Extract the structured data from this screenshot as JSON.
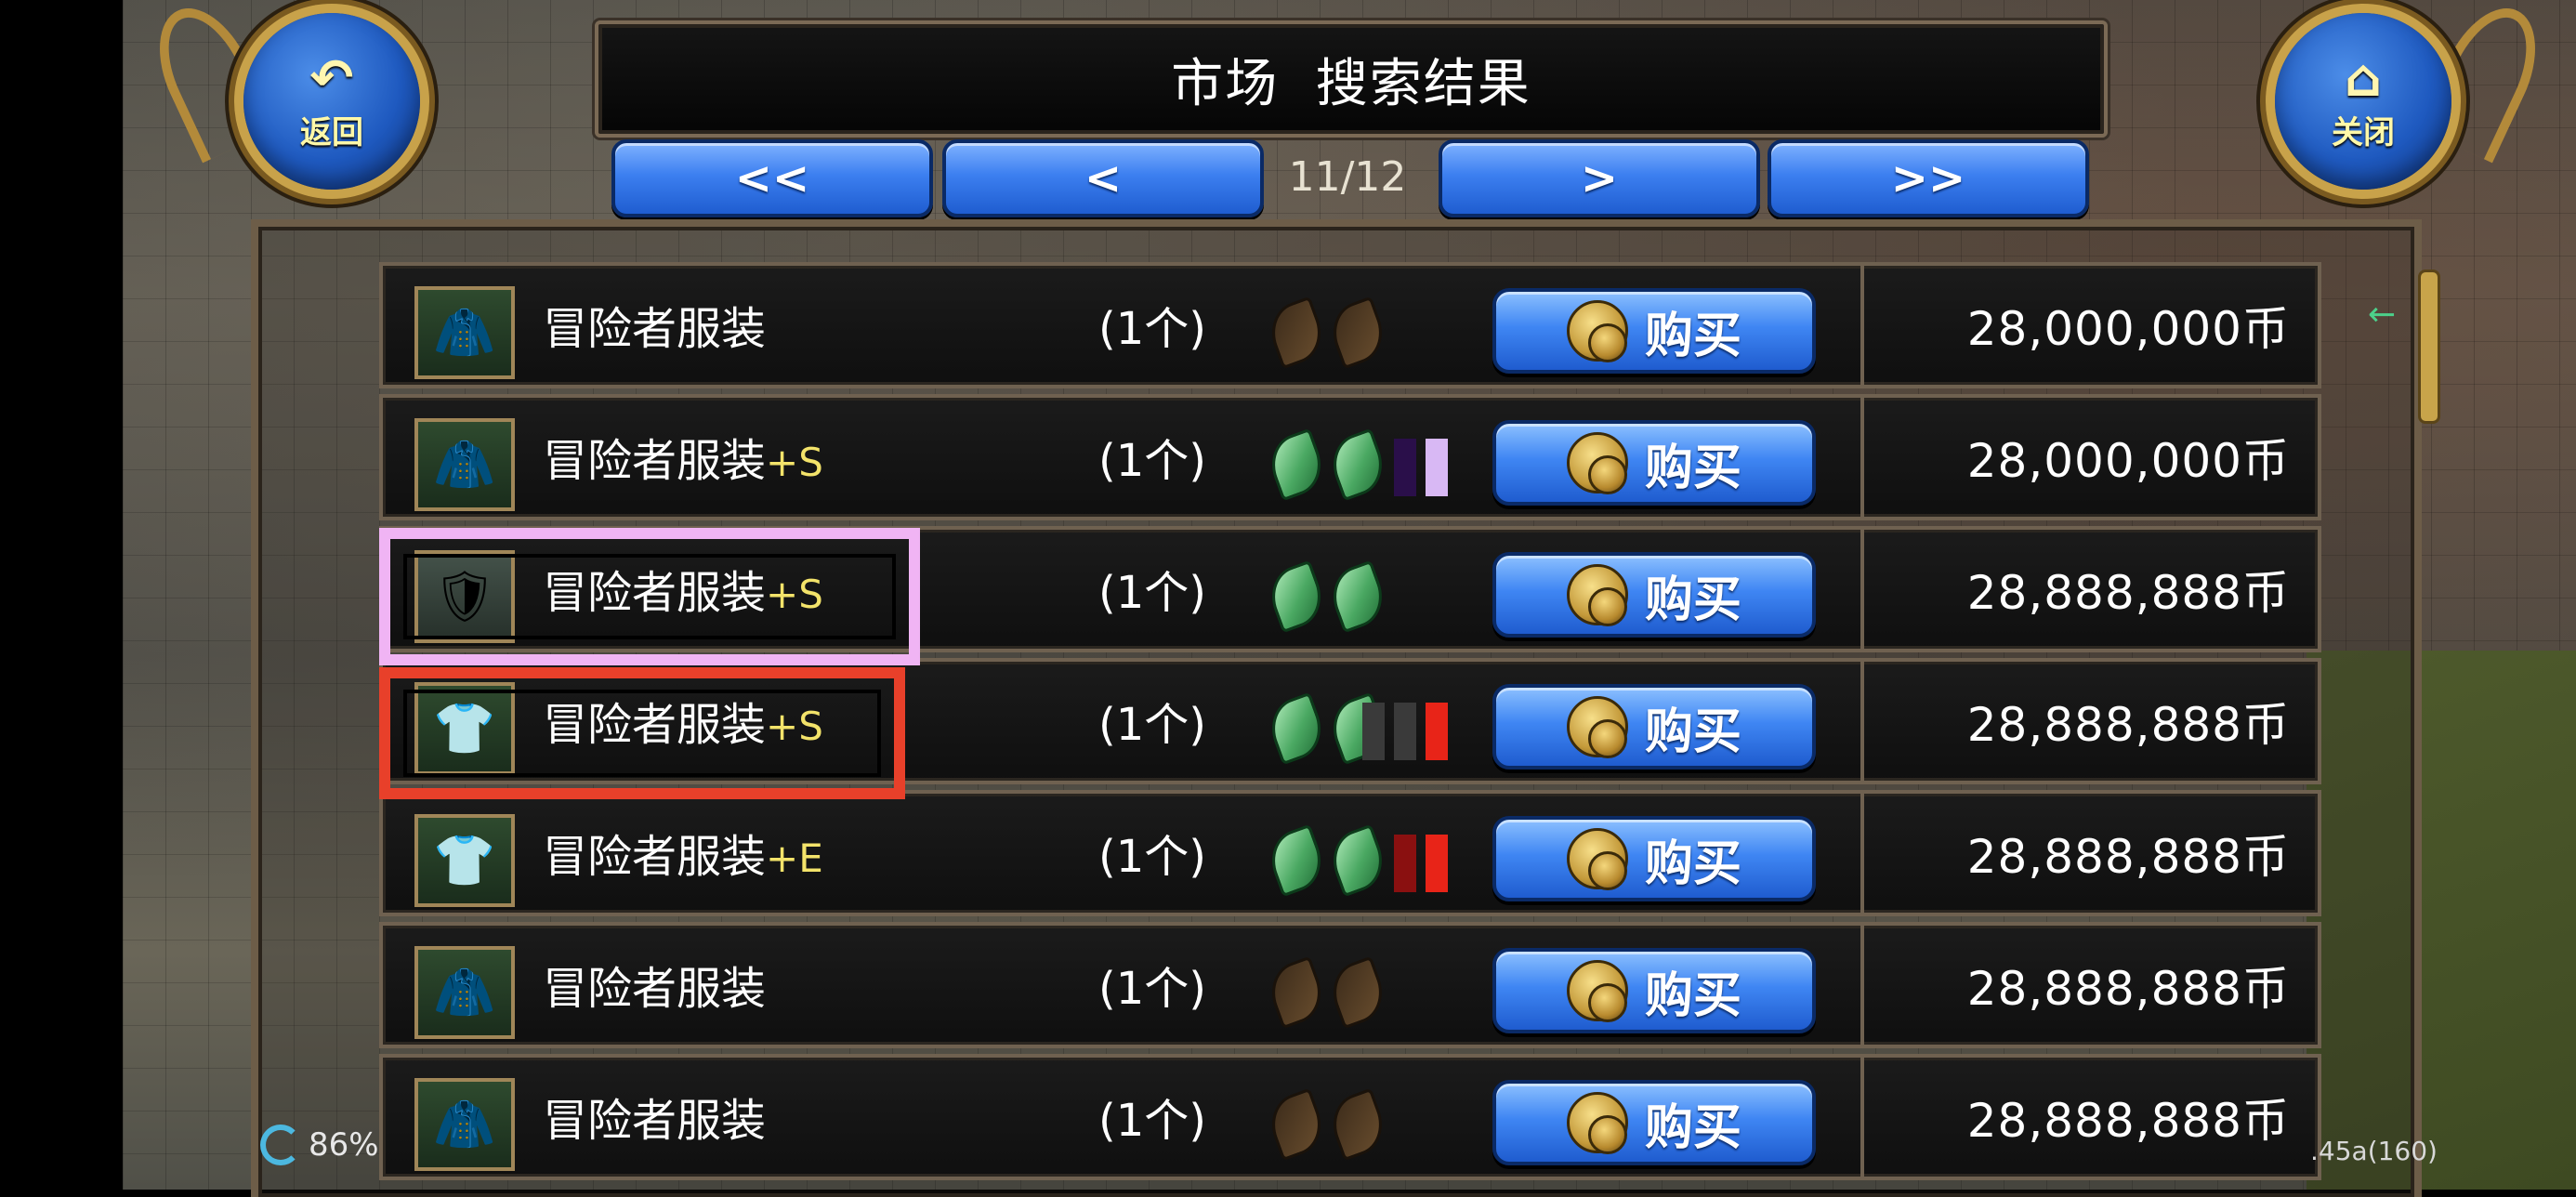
{
  "header": {
    "title": "市场  搜索结果",
    "back_label": "返回",
    "close_label": "关闭"
  },
  "pager": {
    "first": "<<",
    "prev": "<",
    "indicator": "11/12",
    "next": ">",
    "last": ">>"
  },
  "rows": [
    {
      "name": "冒险者服装",
      "suffix": "",
      "qty": "(1个)",
      "leaves": [
        "brown",
        "brown"
      ],
      "bars": [],
      "buy": "购买",
      "price": "28,000,000币",
      "thumb": "gold"
    },
    {
      "name": "冒险者服装",
      "suffix": "+S",
      "qty": "(1个)",
      "leaves": [
        "green",
        "green"
      ],
      "bars": [
        "#2a0f4a",
        "#d8b8f4"
      ],
      "buy": "购买",
      "price": "28,000,000币",
      "thumb": "gold"
    },
    {
      "name": "冒险者服装",
      "suffix": "+S",
      "qty": "(1个)",
      "leaves": [
        "green",
        "green"
      ],
      "bars": [],
      "buy": "购买",
      "price": "28,888,888币",
      "thumb": "silver"
    },
    {
      "name": "冒险者服装",
      "suffix": "+S",
      "qty": "(1个)",
      "leaves": [
        "green",
        "green"
      ],
      "bars": [
        "#3a3a3a",
        "#3a3a3a",
        "#e82418"
      ],
      "buy": "购买",
      "price": "28,888,888币",
      "thumb": "white"
    },
    {
      "name": "冒险者服装",
      "suffix": "+E",
      "qty": "(1个)",
      "leaves": [
        "green",
        "green"
      ],
      "bars": [
        "#8a1010",
        "#e82418"
      ],
      "buy": "购买",
      "price": "28,888,888币",
      "thumb": "white"
    },
    {
      "name": "冒险者服装",
      "suffix": "",
      "qty": "(1个)",
      "leaves": [
        "brown",
        "brown"
      ],
      "bars": [],
      "buy": "购买",
      "price": "28,888,888币",
      "thumb": "gold"
    },
    {
      "name": "冒险者服装",
      "suffix": "",
      "qty": "(1个)",
      "leaves": [
        "brown",
        "brown"
      ],
      "bars": [],
      "buy": "购买",
      "price": "28,888,888币",
      "thumb": "gold"
    }
  ],
  "highlights": {
    "pink_color": "#f0b4f4",
    "red_color": "#e8402a"
  },
  "footer": {
    "battery": "86%",
    "version": ".45a(160)"
  }
}
